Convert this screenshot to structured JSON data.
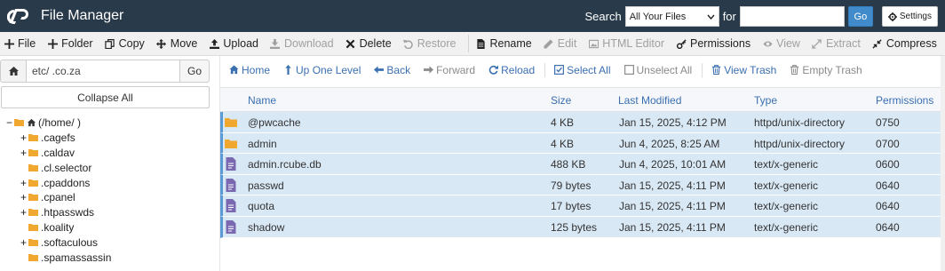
{
  "header": {
    "title": "File Manager",
    "search_label": "Search",
    "search_scope": "All Your Files",
    "for_label": "for",
    "search_value": "",
    "go_label": "Go",
    "settings_label": "Settings",
    "bg_color": "#293a4a"
  },
  "toolbar": [
    {
      "label": "File",
      "icon": "plus-icon",
      "disabled": false
    },
    {
      "label": "Folder",
      "icon": "plus-icon",
      "disabled": false
    },
    {
      "label": "Copy",
      "icon": "copy-icon",
      "disabled": false
    },
    {
      "label": "Move",
      "icon": "move-icon",
      "disabled": false
    },
    {
      "label": "Upload",
      "icon": "upload-icon",
      "disabled": false
    },
    {
      "label": "Download",
      "icon": "download-icon",
      "disabled": true
    },
    {
      "label": "Delete",
      "icon": "times-icon",
      "disabled": false
    },
    {
      "label": "Restore",
      "icon": "undo-icon",
      "disabled": true
    },
    {
      "label": "Rename",
      "icon": "file-icon",
      "disabled": false
    },
    {
      "label": "Edit",
      "icon": "pencil-icon",
      "disabled": true
    },
    {
      "label": "HTML Editor",
      "icon": "image-edit-icon",
      "disabled": true
    },
    {
      "label": "Permissions",
      "icon": "key-icon",
      "disabled": false
    },
    {
      "label": "View",
      "icon": "eye-icon",
      "disabled": true
    },
    {
      "label": "Extract",
      "icon": "expand-icon",
      "disabled": true
    },
    {
      "label": "Compress",
      "icon": "compress-icon",
      "disabled": false
    }
  ],
  "left": {
    "path_value": "etc/                        .co.za",
    "go_label": "Go",
    "collapse_label": "Collapse All",
    "root_label": "(/home/                    )",
    "tree": [
      {
        "label": ".cagefs",
        "expandable": true
      },
      {
        "label": ".caldav",
        "expandable": true
      },
      {
        "label": ".cl.selector",
        "expandable": false
      },
      {
        "label": ".cpaddons",
        "expandable": true
      },
      {
        "label": ".cpanel",
        "expandable": true
      },
      {
        "label": ".htpasswds",
        "expandable": true
      },
      {
        "label": ".koality",
        "expandable": false
      },
      {
        "label": ".softaculous",
        "expandable": true
      },
      {
        "label": ".spamassassin",
        "expandable": false
      }
    ]
  },
  "nav": [
    {
      "label": "Home",
      "icon": "home-icon",
      "disabled": false
    },
    {
      "label": "Up One Level",
      "icon": "level-up-icon",
      "disabled": false
    },
    {
      "label": "Back",
      "icon": "arrow-left-icon",
      "disabled": false
    },
    {
      "label": "Forward",
      "icon": "arrow-right-icon",
      "disabled": true
    },
    {
      "label": "Reload",
      "icon": "refresh-icon",
      "disabled": false
    },
    {
      "label": "Select All",
      "icon": "check-square-icon",
      "disabled": false
    },
    {
      "label": "Unselect All",
      "icon": "square-icon",
      "disabled": true
    },
    {
      "label": "View Trash",
      "icon": "trash-icon",
      "disabled": false
    },
    {
      "label": "Empty Trash",
      "icon": "trash-icon",
      "disabled": true
    }
  ],
  "table": {
    "columns": [
      "Name",
      "Size",
      "Last Modified",
      "Type",
      "Permissions"
    ],
    "rows": [
      {
        "kind": "folder",
        "name": "@pwcache",
        "size": "4 KB",
        "modified": "Jan 15, 2025, 4:12 PM",
        "type": "httpd/unix-directory",
        "perms": "0750"
      },
      {
        "kind": "folder",
        "name": "admin",
        "size": "4 KB",
        "modified": "Jun 4, 2025, 8:25 AM",
        "type": "httpd/unix-directory",
        "perms": "0700"
      },
      {
        "kind": "file",
        "name": "admin.rcube.db",
        "size": "488 KB",
        "modified": "Jun 4, 2025, 10:01 AM",
        "type": "text/x-generic",
        "perms": "0600"
      },
      {
        "kind": "file",
        "name": "passwd",
        "size": "79 bytes",
        "modified": "Jan 15, 2025, 4:11 PM",
        "type": "text/x-generic",
        "perms": "0640"
      },
      {
        "kind": "file",
        "name": "quota",
        "size": "17 bytes",
        "modified": "Jan 15, 2025, 4:11 PM",
        "type": "text/x-generic",
        "perms": "0640"
      },
      {
        "kind": "file",
        "name": "shadow",
        "size": "125 bytes",
        "modified": "Jan 15, 2025, 4:11 PM",
        "type": "text/x-generic",
        "perms": "0640"
      }
    ],
    "selected_color": "#d9e8f5",
    "folder_color": "#f0a830",
    "file_color": "#7a68b0"
  }
}
